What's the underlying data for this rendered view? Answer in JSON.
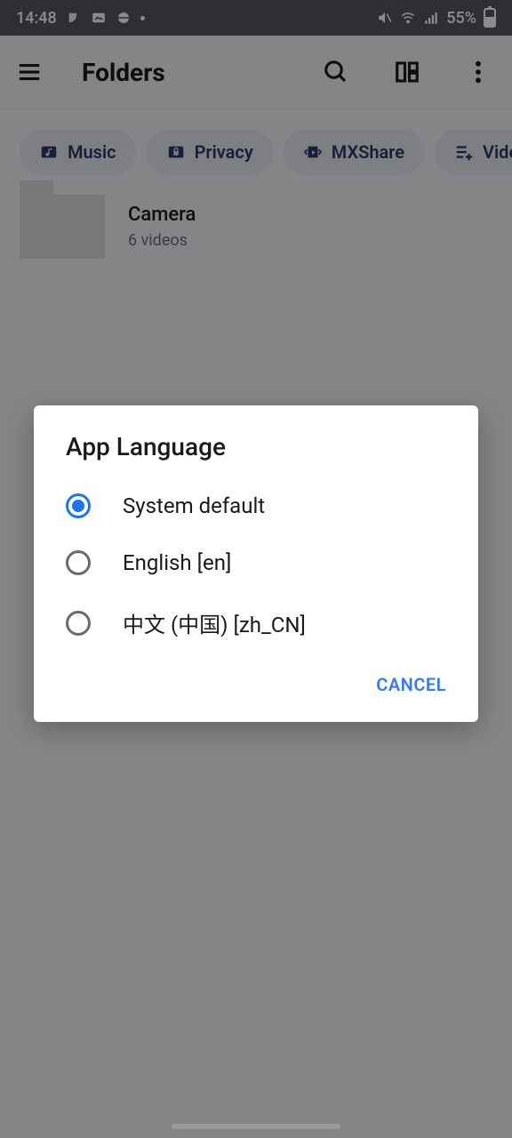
{
  "status": {
    "time": "14:48",
    "battery_pct": "55%"
  },
  "appbar": {
    "title": "Folders"
  },
  "chips": [
    {
      "icon": "music",
      "label": "Music"
    },
    {
      "icon": "lock",
      "label": "Privacy"
    },
    {
      "icon": "share",
      "label": "MXShare"
    },
    {
      "icon": "playlist",
      "label": "Video"
    }
  ],
  "folder": {
    "name": "Camera",
    "subtitle": "6 videos"
  },
  "dialog": {
    "title": "App Language",
    "options": [
      {
        "label": "System default",
        "selected": true
      },
      {
        "label": "English [en]",
        "selected": false
      },
      {
        "label": "中文 (中国) [zh_CN]",
        "selected": false
      }
    ],
    "cancel": "CANCEL"
  }
}
